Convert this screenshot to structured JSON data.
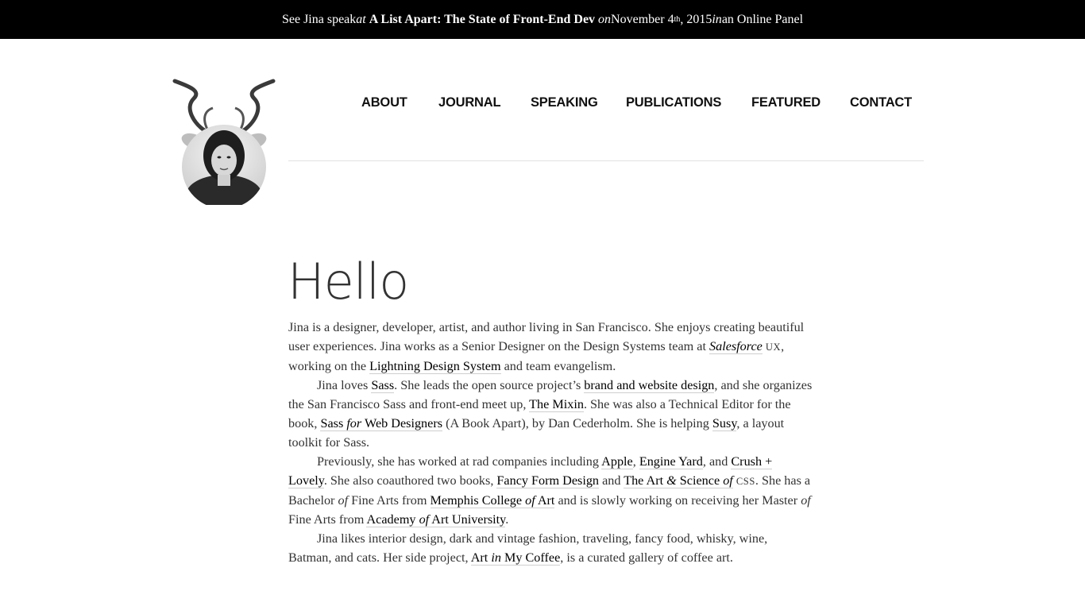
{
  "announcement": {
    "t1": "See Jina speak ",
    "t2": "at",
    "event": "A List Apart: The State of Front-End Dev",
    "t3": "on",
    "date_a": " November 4",
    "date_sup": "th",
    "date_b": ", 2015 ",
    "t4": "in",
    "t5": " an Online Panel"
  },
  "nav": [
    "ABOUT",
    "JOURNAL",
    "SPEAKING",
    "PUBLICATIONS",
    "FEATURED",
    "CONTACT"
  ],
  "heading": "Hello",
  "bio": {
    "p1": {
      "a": "Jina is a designer, developer, artist, and author living in San Francisco. She enjoys creating beautiful user experiences. Jina works as a Senior Designer on the Design Systems team at ",
      "salesforce": "Salesforce",
      "ux": "UX",
      "b": ", working on the ",
      "lightning": "Lightning Design System",
      "c": " and team evangelism."
    },
    "p2": {
      "a": "Jina loves ",
      "sass": "Sass",
      "b": ". She leads the open source project’s ",
      "brand": "brand and website design",
      "c": ", and she organizes the San Francisco Sass and front-end meet up, ",
      "mixin": "The Mixin",
      "d": ". She was also a Technical Editor for the book, ",
      "book1": "Sass ",
      "book2": "for",
      "book3": " Web Designers",
      "e": " (A Book Apart), by Dan Cederholm. She is helping ",
      "susy": "Susy",
      "f": ", a layout toolkit for Sass."
    },
    "p3": {
      "a": "Previously, she has worked at rad companies including ",
      "apple": "Apple",
      "b": ", ",
      "engineyard": "Engine Yard",
      "c": ", and ",
      "crush": "Crush + Lovely",
      "d": ". She also coauthored two books, ",
      "fancy": "Fancy Form Design",
      "e": " and ",
      "art1": "The Art ",
      "art2": "&",
      "art3": " Science ",
      "art4": "of",
      "css": "CSS",
      "f": ". She has a Bachelor ",
      "of1": "of",
      "g": " Fine Arts from ",
      "memphis1": "Memphis College ",
      "memphis2": "of",
      "memphis3": " Art",
      "h": " and is slowly working on receiving her Master ",
      "of2": "of",
      "i": " Fine Arts from ",
      "academy1": "Academy ",
      "academy2": "of",
      "academy3": " Art University",
      "j": "."
    },
    "p4": {
      "a": "Jina likes interior design, dark and vintage fashion, traveling, fancy food, whisky, wine, Batman, and cats. Her side project, ",
      "aimc1": "Art ",
      "aimc2": "in",
      "aimc3": " My Coffee",
      "b": ", is a curated gallery of coffee art."
    }
  }
}
